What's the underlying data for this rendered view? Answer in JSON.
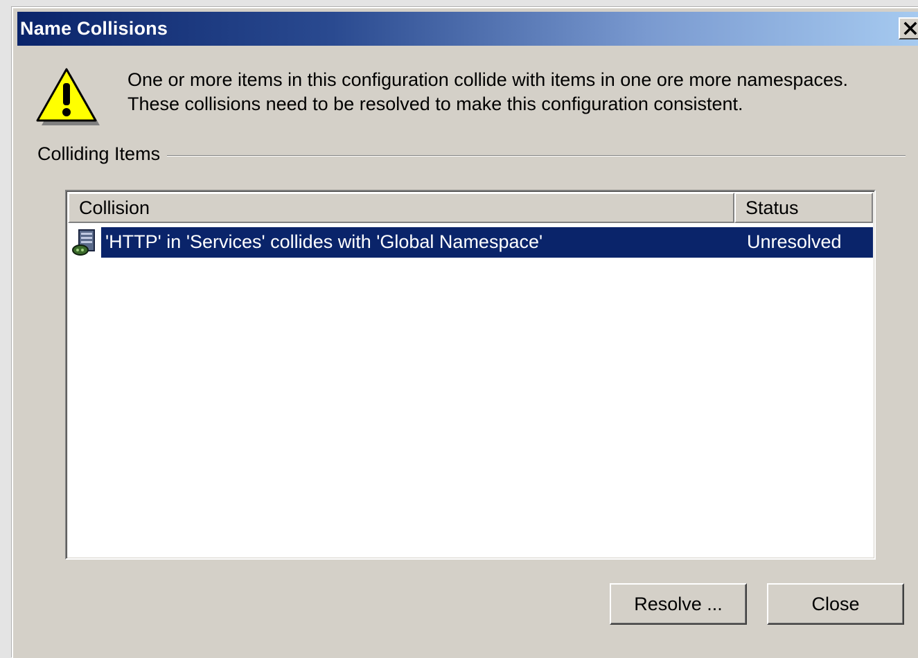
{
  "window": {
    "title": "Name Collisions",
    "close_glyph": "✕"
  },
  "icons": {
    "warning": "warning-icon",
    "row_item": "server-item-icon",
    "close": "close-icon"
  },
  "message": {
    "line1": "One or more items in this configuration collide with items in one ore more namespaces.",
    "line2": "These collisions need to be resolved to make this configuration consistent."
  },
  "group": {
    "label": "Colliding Items"
  },
  "list": {
    "columns": [
      "Collision",
      "Status"
    ],
    "rows": [
      {
        "collision": "'HTTP' in 'Services' collides with 'Global Namespace'",
        "status": "Unresolved",
        "selected": true
      }
    ]
  },
  "buttons": {
    "resolve": "Resolve ...",
    "close": "Close"
  },
  "colors": {
    "title_gradient_start": "#0a246a",
    "title_gradient_end": "#a6caf0",
    "selection": "#0a246a",
    "dialog_face": "#d4d0c8",
    "warning_yellow": "#ffff00"
  }
}
